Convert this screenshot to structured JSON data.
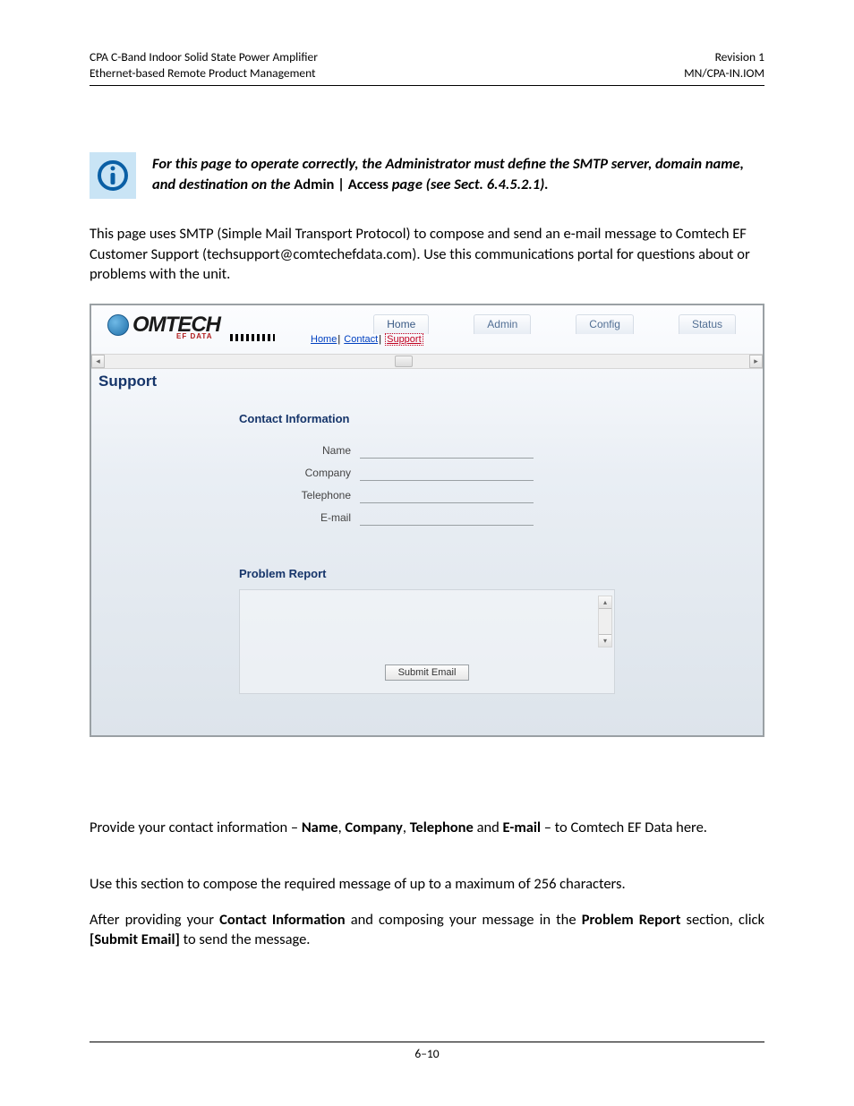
{
  "header": {
    "left_line1": "CPA C-Band Indoor Solid State Power Amplifier",
    "left_line2": "Ethernet-based Remote Product Management",
    "right_line1": "Revision 1",
    "right_line2": "MN/CPA-IN.IOM"
  },
  "callout": {
    "seg1": "For this page to operate correctly, the Administrator must define the SMTP server, domain name, and destination on the ",
    "seg2": "Admin | Access",
    "seg3": " page (see Sect. 6.4.5.2.1)."
  },
  "intro_paragraph": "This page uses SMTP (Simple Mail Transport Protocol) to compose and send an e-mail message to Comtech EF Customer Support (techsupport@comtechefdata.com). Use this communications portal for questions about or problems with the unit.",
  "webui": {
    "logo": {
      "word": "OMTECH",
      "sub": "EF DATA"
    },
    "main_tabs": [
      "Home",
      "Admin",
      "Config",
      "Status"
    ],
    "active_main_tab_index": 0,
    "sub_tabs": [
      "Home",
      "Contact",
      "Support"
    ],
    "active_sub_tab_index": 2,
    "page_title": "Support",
    "sections": {
      "contact_heading": "Contact Information",
      "fields": [
        {
          "label": "Name",
          "value": ""
        },
        {
          "label": "Company",
          "value": ""
        },
        {
          "label": "Telephone",
          "value": ""
        },
        {
          "label": "E-mail",
          "value": ""
        }
      ],
      "report_heading": "Problem Report",
      "report_value": "",
      "submit_label": "Submit Email"
    }
  },
  "para_contact": {
    "t1": "Provide your contact information – ",
    "b1": "Name",
    "t2": ", ",
    "b2": "Company",
    "t3": ", ",
    "b3": "Telephone",
    "t4": " and ",
    "b4": "E-mail",
    "t5": " – to Comtech EF Data here."
  },
  "para_compose": "Use this section to compose the required message of up to a maximum of 256 characters.",
  "para_submit": {
    "t1": "After providing your ",
    "b1": "Contact Information",
    "t2": " and composing your message in the ",
    "b2": "Problem Report",
    "t3": " section, click ",
    "b3": "[Submit Email]",
    "t4": " to send the message."
  },
  "footer_page": "6–10"
}
